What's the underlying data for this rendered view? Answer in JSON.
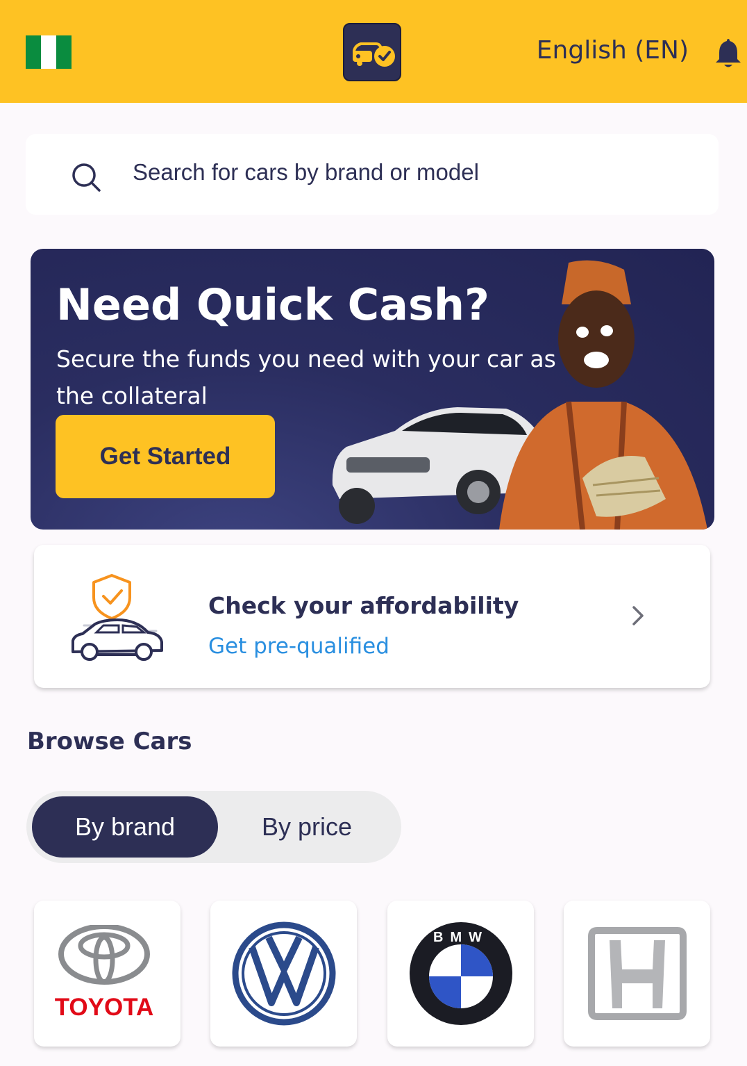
{
  "header": {
    "language_label": "English (EN)",
    "icons": [
      "nigeria-flag",
      "app-logo-icon",
      "bell-icon"
    ]
  },
  "search": {
    "placeholder": "Search for cars by brand or model",
    "icon": "search-icon"
  },
  "banner": {
    "title": "Need Quick Cash?",
    "subtitle": "Secure the funds you need with your car as the collateral",
    "cta_label": "Get Started"
  },
  "affordability": {
    "title": "Check your affordability",
    "link": "Get pre-qualified",
    "icon": "car-shield-icon"
  },
  "browse": {
    "title": "Browse Cars",
    "tabs": [
      {
        "label": "By brand",
        "selected": true
      },
      {
        "label": "By price",
        "selected": false
      }
    ],
    "brands": [
      {
        "name": "Toyota",
        "logo_text": "TOYOTA"
      },
      {
        "name": "Volkswagen",
        "logo_text": ""
      },
      {
        "name": "BMW",
        "logo_text": "BMW"
      },
      {
        "name": "Honda",
        "logo_text": ""
      }
    ]
  },
  "colors": {
    "accent_yellow": "#fec223",
    "navy": "#2d2f55",
    "link_blue": "#2a8fe0"
  }
}
